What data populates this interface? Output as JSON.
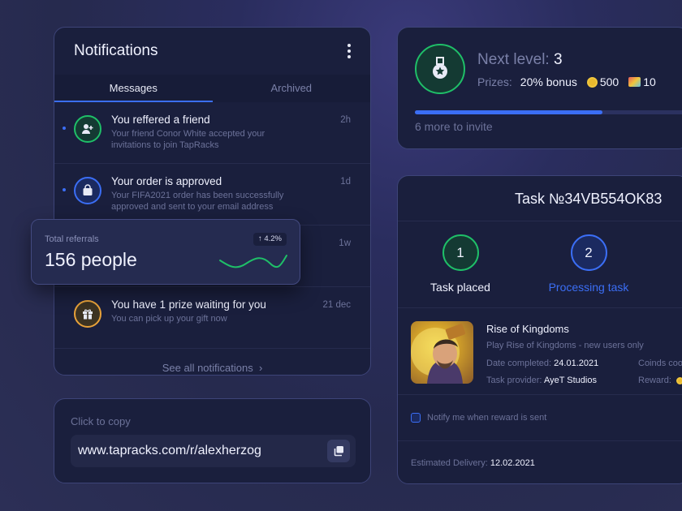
{
  "notifications": {
    "title": "Notifications",
    "tabs": [
      {
        "label": "Messages"
      },
      {
        "label": "Archived"
      }
    ],
    "items": [
      {
        "title": "You reffered a friend",
        "desc": "Your friend Conor White accepted your invitations to join TapRacks",
        "time": "2h"
      },
      {
        "title": "Your order is approved",
        "desc": "Your FIFA2021 order has been successfully approved and sent to your email address",
        "time": "1d"
      },
      {
        "title": "",
        "desc": "",
        "time": "1w"
      },
      {
        "title": "You have 1 prize waiting for you",
        "desc": "You can pick up your gift now",
        "time": "21 dec"
      }
    ],
    "see_all": "See all notifications"
  },
  "referrals": {
    "label": "Total referrals",
    "value": "156 people",
    "change": "4.2%"
  },
  "copy": {
    "label": "Click to copy",
    "url": "www.tapracks.com/r/alexherzog"
  },
  "level": {
    "title": "Next level:",
    "number": "3",
    "prizes_label": "Prizes:",
    "bonus": "20% bonus",
    "coins": "500",
    "tickets": "10",
    "progress": 0.68,
    "invite_text": "6 more to invite"
  },
  "task": {
    "title": "Task №34VB554OK83",
    "steps": [
      {
        "number": "1",
        "label": "Task placed"
      },
      {
        "number": "2",
        "label": "Processing task"
      }
    ],
    "game": {
      "title": "Rise of Kingdoms",
      "subtitle": "Play Rise of Kingdoms - new users only",
      "date_label": "Date completed:",
      "date_value": "24.01.2021",
      "provider_label": "Task provider:",
      "provider_value": "AyeT Studios",
      "coins_label": "Coinds coo",
      "reward_label": "Reward:"
    },
    "notify_label": "Notify me when reward is sent",
    "delivery_label": "Estimated Delivery:",
    "delivery_value": "12.02.2021"
  },
  "colors": {
    "accent": "#3b6ef5",
    "success": "#1fbf68",
    "warning": "#e8a23a"
  }
}
